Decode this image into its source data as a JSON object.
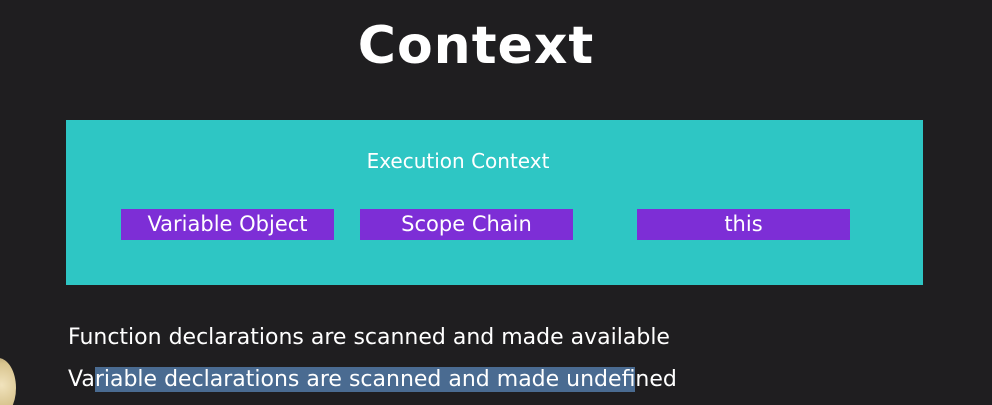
{
  "slide": {
    "title": "Context",
    "execution_context": {
      "label": "Execution Context",
      "items": [
        {
          "label": "Variable Object"
        },
        {
          "label": "Scope Chain"
        },
        {
          "label": "this"
        }
      ]
    },
    "lines": {
      "line1": "Function declarations are scanned and made available",
      "line2_before": "Va",
      "line2_highlight": "riable declarations are scanned and made unde",
      "line2_highlight_end": "fi",
      "line2_after": "ned"
    }
  },
  "colors": {
    "background": "#1f1e20",
    "execution_context_box": "#2ec6c4",
    "item_box": "#7d2ed6",
    "text_highlight": "#4a6b91",
    "text": "#ffffff"
  }
}
